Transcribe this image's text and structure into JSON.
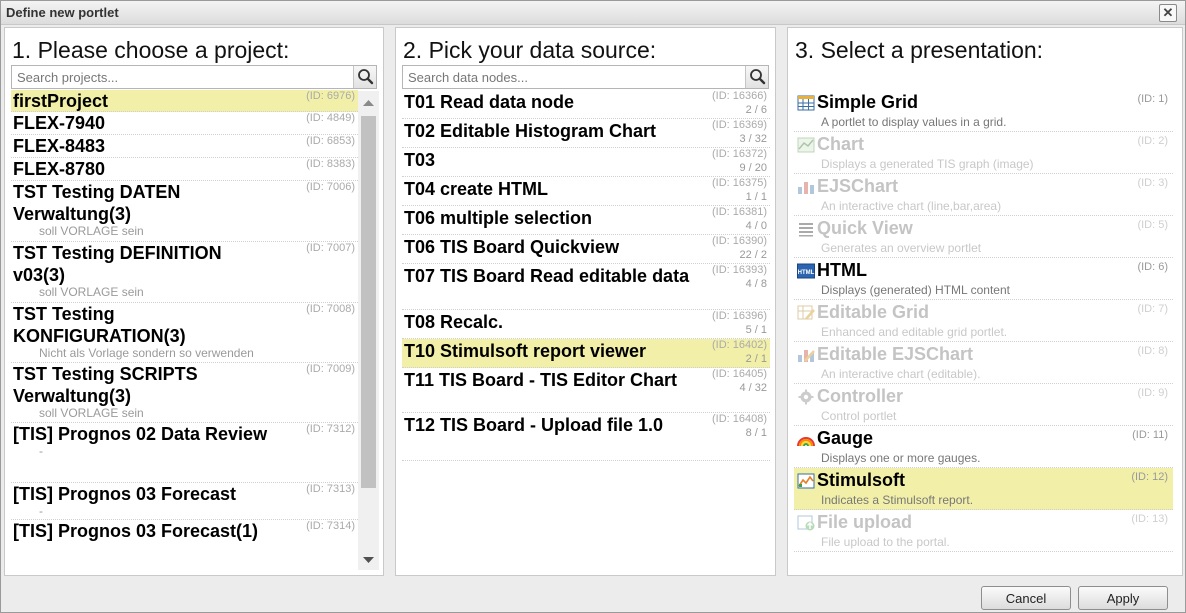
{
  "dialog": {
    "title": "Define new portlet"
  },
  "projects": {
    "heading": "1. Please choose a project:",
    "search_placeholder": "Search projects...",
    "items": [
      {
        "name": "firstProject",
        "id": "(ID: 6976)",
        "sub": ""
      },
      {
        "name": "FLEX-7940",
        "id": "(ID: 4849)",
        "sub": ""
      },
      {
        "name": "FLEX-8483",
        "id": "(ID: 6853)",
        "sub": ""
      },
      {
        "name": "FLEX-8780",
        "id": "(ID: 8383)",
        "sub": ""
      },
      {
        "name": "TST Testing DATEN Verwaltung(3)",
        "id": "(ID: 7006)",
        "sub": "soll VORLAGE sein"
      },
      {
        "name": "TST Testing DEFINITION v03(3)",
        "id": "(ID: 7007)",
        "sub": "soll VORLAGE sein"
      },
      {
        "name": "TST Testing KONFIGURATION(3)",
        "id": "(ID: 7008)",
        "sub": "Nicht als Vorlage sondern so verwenden"
      },
      {
        "name": "TST Testing SCRIPTS Verwaltung(3)",
        "id": "(ID: 7009)",
        "sub": "soll VORLAGE sein"
      },
      {
        "name": "[TIS] Prognos 02 Data Review",
        "id": "(ID: 7312)",
        "sub": "-"
      },
      {
        "name": "[TIS] Prognos 03 Forecast",
        "id": "(ID: 7313)",
        "sub": "-"
      },
      {
        "name": "[TIS] Prognos 03 Forecast(1)",
        "id": "(ID: 7314)",
        "sub": ""
      }
    ]
  },
  "datasources": {
    "heading": "2. Pick your data source:",
    "search_placeholder": "Search data nodes...",
    "items": [
      {
        "name": "T01 Read data node",
        "id": "(ID: 16366)",
        "count": "2 / 6"
      },
      {
        "name": "T02 Editable Histogram Chart",
        "id": "(ID: 16369)",
        "count": "3 / 32"
      },
      {
        "name": "T03",
        "id": "(ID: 16372)",
        "count": "9 / 20"
      },
      {
        "name": "T04 create HTML",
        "id": "(ID: 16375)",
        "count": "1 / 1"
      },
      {
        "name": "T06 multiple selection",
        "id": "(ID: 16381)",
        "count": "4 / 0"
      },
      {
        "name": "T06 TIS Board Quickview",
        "id": "(ID: 16390)",
        "count": "22 / 2"
      },
      {
        "name": "T07 TIS Board Read editable data",
        "id": "(ID: 16393)",
        "count": "4 / 8"
      },
      {
        "name": "T08 Recalc.",
        "id": "(ID: 16396)",
        "count": "5 / 1"
      },
      {
        "name": "T10 Stimulsoft report viewer",
        "id": "(ID: 16402)",
        "count": "2 / 1"
      },
      {
        "name": "T11 TIS Board - TIS Editor Chart",
        "id": "(ID: 16405)",
        "count": "4 / 32"
      },
      {
        "name": "T12 TIS Board - Upload file 1.0",
        "id": "(ID: 16408)",
        "count": "8 / 1"
      }
    ]
  },
  "presentations": {
    "heading": "3. Select a presentation:",
    "items": [
      {
        "name": "Simple Grid",
        "desc": "A portlet to display values in a grid.",
        "id": "(ID: 1)",
        "icon": "grid-icon"
      },
      {
        "name": "Chart",
        "desc": "Displays a generated TIS graph (image)",
        "id": "(ID: 2)",
        "icon": "chart-image-icon"
      },
      {
        "name": "EJSChart",
        "desc": "An interactive chart (line,bar,area)",
        "id": "(ID: 3)",
        "icon": "bar-chart-icon"
      },
      {
        "name": "Quick View",
        "desc": "Generates an overview portlet",
        "id": "(ID: 5)",
        "icon": "list-lines-icon"
      },
      {
        "name": "HTML",
        "desc": "Displays (generated) HTML content",
        "id": "(ID: 6)",
        "icon": "html-icon"
      },
      {
        "name": "Editable Grid",
        "desc": "Enhanced and editable grid portlet.",
        "id": "(ID: 7)",
        "icon": "edit-grid-icon"
      },
      {
        "name": "Editable EJSChart",
        "desc": "An interactive chart (editable).",
        "id": "(ID: 8)",
        "icon": "edit-chart-icon"
      },
      {
        "name": "Controller",
        "desc": "Control portlet",
        "id": "(ID: 9)",
        "icon": "gear-icon"
      },
      {
        "name": "Gauge",
        "desc": "Displays one or more gauges.",
        "id": "(ID: 11)",
        "icon": "rainbow-icon"
      },
      {
        "name": "Stimulsoft",
        "desc": "Indicates a Stimulsoft report.",
        "id": "(ID: 12)",
        "icon": "report-icon"
      },
      {
        "name": "File upload",
        "desc": "File upload to the portal.",
        "id": "(ID: 13)",
        "icon": "upload-icon"
      }
    ]
  },
  "buttons": {
    "cancel": "Cancel",
    "apply": "Apply"
  }
}
